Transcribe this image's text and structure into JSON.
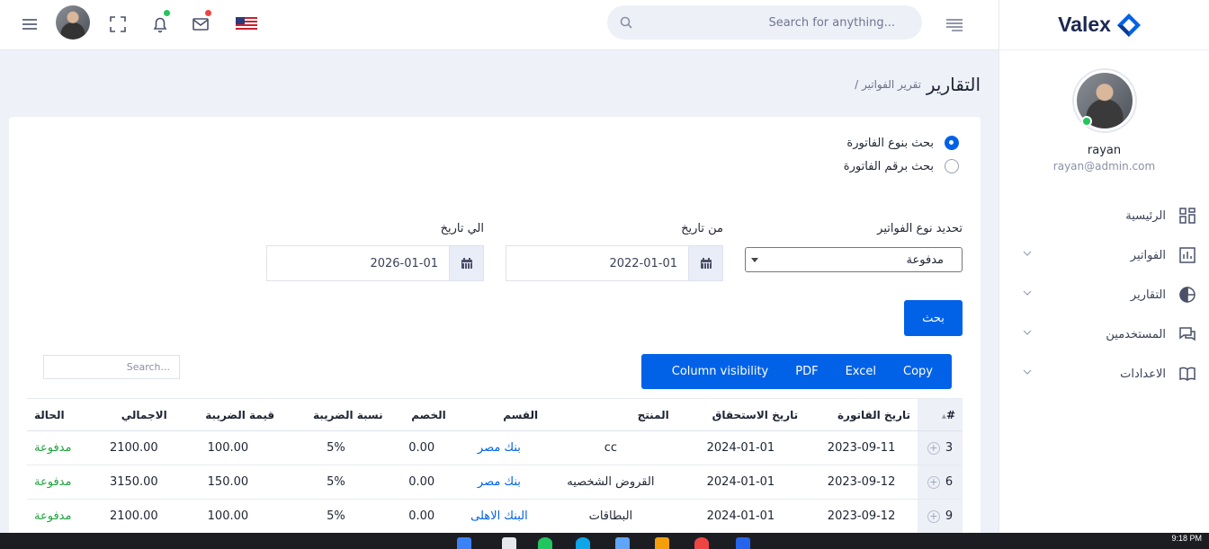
{
  "brand": {
    "name": "Valex"
  },
  "profile": {
    "name": "rayan",
    "email": "rayan@admin.com"
  },
  "sidebar": {
    "items": [
      {
        "label": "الرئيسية",
        "icon": "dashboard-icon",
        "has_chevron": false
      },
      {
        "label": "الفواتير",
        "icon": "chart-bar-icon",
        "has_chevron": true
      },
      {
        "label": "التقارير",
        "icon": "pie-chart-icon",
        "has_chevron": true
      },
      {
        "label": "المستخدمين",
        "icon": "chat-icon",
        "has_chevron": true
      },
      {
        "label": "الاعدادات",
        "icon": "book-icon",
        "has_chevron": true
      }
    ]
  },
  "header": {
    "search_placeholder": "Search for anything...",
    "icons": [
      "hamburger-icon",
      "fullscreen-icon",
      "bell-icon",
      "mail-icon",
      "us-flag-icon",
      "menu-lines-icon",
      "search-icon"
    ],
    "notification_dot_color": "#22c55e",
    "mail_dot_color": "#ef4444"
  },
  "breadcrumb": {
    "title": "التقارير",
    "current": "/ تقرير الفواتير"
  },
  "filters": {
    "radio_type": "بحث بنوع الفاتورة",
    "radio_number": "بحث برقم الفاتورة",
    "selected_radio": "type",
    "type_label": "تحديد نوع الفواتير",
    "type_value": "مدفوعة",
    "from_label": "من تاريخ",
    "from_value": "2022-01-01",
    "to_label": "الي تاريخ",
    "to_value": "2026-01-01",
    "search_button": "بحث"
  },
  "table_tools": {
    "search_placeholder": "Search...",
    "buttons": [
      "Copy",
      "Excel",
      "PDF",
      "Column visibility"
    ]
  },
  "table": {
    "headers": [
      "#",
      "تاريخ القاتورة",
      "تاريخ الاستحقاق",
      "المنتج",
      "القسم",
      "الخصم",
      "نسبة الضريبة",
      "قيمة الضريبة",
      "الاجمالي",
      "الحالة"
    ],
    "rows": [
      [
        "3",
        "2023-09-11",
        "2024-01-01",
        "cc",
        "بنك مصر",
        "0.00",
        "5%",
        "100.00",
        "2100.00",
        "مدفوعة"
      ],
      [
        "6",
        "2023-09-12",
        "2024-01-01",
        "القروض الشخصيه",
        "بنك مصر",
        "0.00",
        "5%",
        "150.00",
        "3150.00",
        "مدفوعة"
      ],
      [
        "9",
        "2023-09-12",
        "2024-01-01",
        "البطاقات",
        "البنك الاهلى",
        "0.00",
        "5%",
        "100.00",
        "2100.00",
        "مدفوعة"
      ]
    ]
  },
  "colors": {
    "accent": "#0162e8",
    "paid": "#22a340"
  },
  "taskbar": {
    "time": "9:18 PM"
  }
}
